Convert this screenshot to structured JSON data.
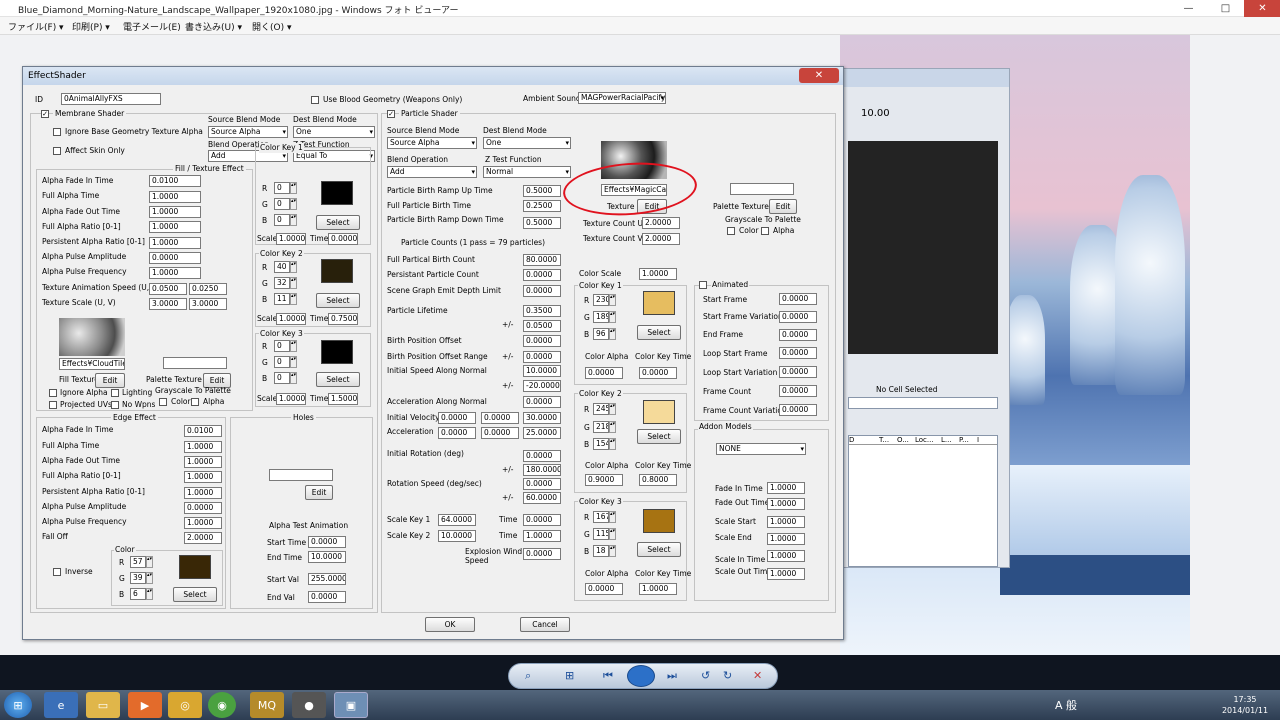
{
  "window": {
    "title": "Blue_Diamond_Morning-Nature_Landscape_Wallpaper_1920x1080.jpg - Windows フォト ビューアー",
    "min": "—",
    "max": "□",
    "close": "✕"
  },
  "menu": [
    "ファイル(F) ▾",
    "印刷(P) ▾",
    "電子メール(E)",
    "書き込み(U) ▾",
    "開く(O) ▾"
  ],
  "background_window": {
    "zoom": "10.00",
    "no_cell": "No Cell Selected",
    "columns": [
      "D",
      "T...",
      "O...",
      "Loc...",
      "L...",
      "P...",
      "I"
    ]
  },
  "dialog": {
    "title": "EffectShader",
    "close": "✕",
    "id_label": "ID",
    "id_value": "0AnimalAllyFXS",
    "use_blood": "Use Blood Geometry (Weapons Only)",
    "ambient_label": "Ambient Sound",
    "ambient_value": "MAGPowerRacialPacifyE",
    "ok": "OK",
    "cancel": "Cancel",
    "membrane": {
      "title": "Membrane Shader",
      "ignore_base": "Ignore Base Geometry Texture Alpha",
      "affect_skin": "Affect Skin Only",
      "src_blend_label": "Source Blend Mode",
      "src_blend": "Source Alpha",
      "dst_blend_label": "Dest Blend Mode",
      "dst_blend": "One",
      "blend_op_label": "Blend Operation",
      "blend_op": "Add",
      "ztest_label": "Z Test Function",
      "ztest": "Equal To",
      "fill_title": "Fill / Texture Effect",
      "fill_fields": [
        {
          "label": "Alpha Fade In Time",
          "value": "0.0100"
        },
        {
          "label": "Full Alpha Time",
          "value": "1.0000"
        },
        {
          "label": "Alpha Fade Out Time",
          "value": "1.0000"
        },
        {
          "label": "Full Alpha Ratio [0-1]",
          "value": "1.0000"
        },
        {
          "label": "Persistent Alpha Ratio [0-1]",
          "value": "1.0000"
        },
        {
          "label": "Alpha Pulse Amplitude",
          "value": "0.0000"
        },
        {
          "label": "Alpha Pulse Frequency",
          "value": "1.0000"
        }
      ],
      "tex_speed_label": "Texture Animation Speed (U, V)",
      "tex_speed_u": "0.0500",
      "tex_speed_v": "0.0250",
      "tex_scale_label": "Texture Scale (U, V)",
      "tex_scale_u": "3.0000",
      "tex_scale_v": "3.0000",
      "fill_texture_name": "Effects¥CloudTileFr",
      "fill_texture_label": "Fill Texture",
      "edit": "Edit",
      "palette_texture_label": "Palette Texture",
      "ignore_alpha": "Ignore Alpha",
      "lighting": "Lighting",
      "grayscale": "Grayscale To Palette",
      "projected_uvs": "Projected UVs",
      "no_wpns": "No Wpns",
      "color": "Color",
      "alpha": "Alpha",
      "color_keys": [
        {
          "title": "Color Key 1",
          "r": "0",
          "g": "0",
          "b": "0",
          "scale": "1.0000",
          "time": "0.0000",
          "swatch": "#000000"
        },
        {
          "title": "Color Key 2",
          "r": "40",
          "g": "32",
          "b": "11",
          "scale": "1.0000",
          "time": "0.7500",
          "swatch": "#28200b"
        },
        {
          "title": "Color Key 3",
          "r": "0",
          "g": "0",
          "b": "0",
          "scale": "1.0000",
          "time": "1.5000",
          "swatch": "#000000"
        }
      ],
      "edge_title": "Edge Effect",
      "edge_fields": [
        {
          "label": "Alpha Fade In Time",
          "value": "0.0100"
        },
        {
          "label": "Full Alpha Time",
          "value": "1.0000"
        },
        {
          "label": "Alpha Fade Out Time",
          "value": "1.0000"
        },
        {
          "label": "Full Alpha Ratio [0-1]",
          "value": "1.0000"
        },
        {
          "label": "Persistent Alpha Ratio [0-1]",
          "value": "1.0000"
        },
        {
          "label": "Alpha Pulse Amplitude",
          "value": "0.0000"
        },
        {
          "label": "Alpha Pulse Frequency",
          "value": "1.0000"
        },
        {
          "label": "Fall Off",
          "value": "2.0000"
        }
      ],
      "edge_color": {
        "title": "Color",
        "r": "57",
        "g": "39",
        "b": "6",
        "swatch": "#392706"
      },
      "inverse": "Inverse",
      "holes_title": "Holes",
      "alpha_test_title": "Alpha Test Animation",
      "alpha_test": [
        {
          "label": "Start Time",
          "value": "0.0000"
        },
        {
          "label": "End Time",
          "value": "10.0000"
        },
        {
          "label": "Start Val",
          "value": "255.0000"
        },
        {
          "label": "End Val",
          "value": "0.0000"
        }
      ],
      "select": "Select",
      "scale": "Scale",
      "time": "Time"
    },
    "particle": {
      "title": "Particle Shader",
      "src_blend": "Source Alpha",
      "dst_blend": "One",
      "blend_op": "Add",
      "ztest": "Normal",
      "birth_fields": [
        {
          "label": "Particle Birth Ramp Up Time",
          "value": "0.5000"
        },
        {
          "label": "Full Particle Birth Time",
          "value": "0.2500"
        },
        {
          "label": "Particle Birth Ramp Down Time",
          "value": "0.5000"
        }
      ],
      "counts_note": "Particle Counts (1 pass = 79 particles)",
      "rows": [
        {
          "label": "Full Partical Birth Count",
          "value": "80.0000"
        },
        {
          "label": "Persistant Particle Count",
          "value": "0.0000"
        },
        {
          "label": "Scene Graph Emit Depth Limit",
          "value": "0.0000"
        },
        {
          "label": "Particle Lifetime",
          "value": "0.3500"
        },
        {
          "label": "+/-",
          "value": "0.0500"
        },
        {
          "label": "Birth Position Offset",
          "value": "0.0000"
        },
        {
          "label": "Birth Position Offset Range",
          "pm": "+/-",
          "value": "0.0000"
        },
        {
          "label": "Initial Speed Along Normal",
          "value": "10.0000"
        },
        {
          "label": "+/-",
          "value": "-20.0000"
        },
        {
          "label": "Acceleration Along Normal",
          "value": "0.0000"
        }
      ],
      "vec_rows": [
        {
          "label": "Initial Velocity",
          "x": "0.0000",
          "y": "0.0000",
          "z": "30.0000"
        },
        {
          "label": "Acceleration",
          "x": "0.0000",
          "y": "0.0000",
          "z": "25.0000"
        }
      ],
      "rot_rows": [
        {
          "label": "Initial Rotation (deg)",
          "value": "0.0000"
        },
        {
          "label": "+/-",
          "value": "180.0000"
        },
        {
          "label": "Rotation Speed (deg/sec)",
          "value": "0.0000"
        },
        {
          "label": "+/-",
          "value": "60.0000"
        }
      ],
      "scale_key1_label": "Scale Key 1",
      "scale_key1": "64.0000",
      "scale_key1_time": "0.0000",
      "scale_key2_label": "Scale Key 2",
      "scale_key2": "10.0000",
      "scale_key2_time": "1.0000",
      "explosion_label1": "Explosion Wind",
      "explosion_label2": "Speed",
      "explosion": "0.0000",
      "texture_name": "Effects¥MagicCaus",
      "texture_label": "Texture",
      "tex_count_u_label": "Texture Count U",
      "tex_count_u": "2.0000",
      "tex_count_v_label": "Texture Count V",
      "tex_count_v": "2.0000",
      "palette_texture_label": "Palette Texture",
      "grayscale": "Grayscale To Palette",
      "color": "Color",
      "alpha": "Alpha",
      "color_scale_label": "Color Scale",
      "color_scale": "1.0000",
      "color_keys": [
        {
          "title": "Color Key 1",
          "r": "230",
          "g": "189",
          "b": "96",
          "alpha": "0.0000",
          "time": "0.0000",
          "swatch": "#e6bd60"
        },
        {
          "title": "Color Key 2",
          "r": "245",
          "g": "218",
          "b": "154",
          "alpha": "0.9000",
          "time": "0.8000",
          "swatch": "#f5da9a"
        },
        {
          "title": "Color Key 3",
          "r": "167",
          "g": "115",
          "b": "18",
          "alpha": "0.0000",
          "time": "1.0000",
          "swatch": "#a77312"
        }
      ],
      "color_alpha": "Color Alpha",
      "color_key_time": "Color Key Time",
      "animated": "Animated",
      "anim_fields": [
        {
          "label": "Start Frame",
          "value": "0.0000"
        },
        {
          "label": "Start Frame Variation",
          "value": "0.0000"
        },
        {
          "label": "End Frame",
          "value": "0.0000"
        },
        {
          "label": "Loop Start Frame",
          "value": "0.0000"
        },
        {
          "label": "Loop Start Variation",
          "value": "0.0000"
        },
        {
          "label": "Frame Count",
          "value": "0.0000"
        },
        {
          "label": "Frame Count Variation",
          "value": "0.0000"
        }
      ],
      "addon_title": "Addon Models",
      "addon_value": "NONE",
      "addon_fields": [
        {
          "label": "Fade In Time",
          "value": "1.0000"
        },
        {
          "label": "Fade Out Time",
          "value": "1.0000"
        },
        {
          "label": "Scale Start",
          "value": "1.0000"
        },
        {
          "label": "Scale End",
          "value": "1.0000"
        },
        {
          "label": "Scale In Time",
          "value": "1.0000"
        },
        {
          "label": "Scale Out Time",
          "value": "1.0000"
        }
      ]
    }
  },
  "taskbar": {
    "time": "17:35",
    "date": "2014/01/11",
    "ime": "A 般"
  }
}
